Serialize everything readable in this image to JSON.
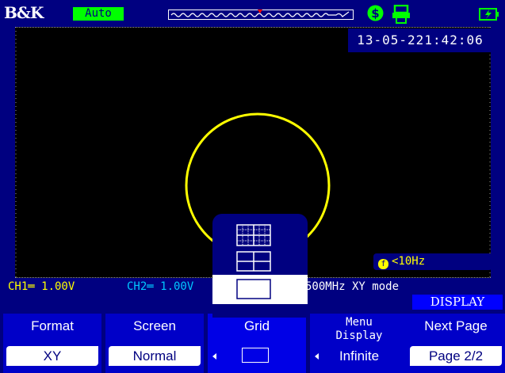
{
  "header": {
    "brand": "B&K",
    "mode": "Auto",
    "icons": [
      "trigger-position-bar",
      "dollar-circle-icon",
      "printer-icon",
      "battery-charging-icon"
    ],
    "colors": {
      "mode_badge": "#00ff00",
      "status_icons": "#00ff00"
    }
  },
  "screen": {
    "datetime": "13-05-221:42:06",
    "frequency": "<10Hz",
    "trace_color": "#ffff00",
    "display_mode": "XY"
  },
  "channel_info": {
    "ch1": "CH1═ 1.00V",
    "ch2": "CH2═ 1.00V",
    "timebase": "500MHz  XY mode"
  },
  "menu": {
    "title": "DISPLAY",
    "grid_popup_options": [
      "full-grid",
      "cross-grid",
      "no-grid"
    ],
    "grid_popup_selected": "no-grid",
    "softkeys": [
      {
        "label": "Format",
        "value": "XY"
      },
      {
        "label": "Screen",
        "value": "Normal"
      },
      {
        "label": "Grid",
        "value": ""
      },
      {
        "label": "Menu\nDisplay",
        "value": "Infinite"
      },
      {
        "label": "Next Page",
        "value": "Page 2/2"
      }
    ]
  }
}
